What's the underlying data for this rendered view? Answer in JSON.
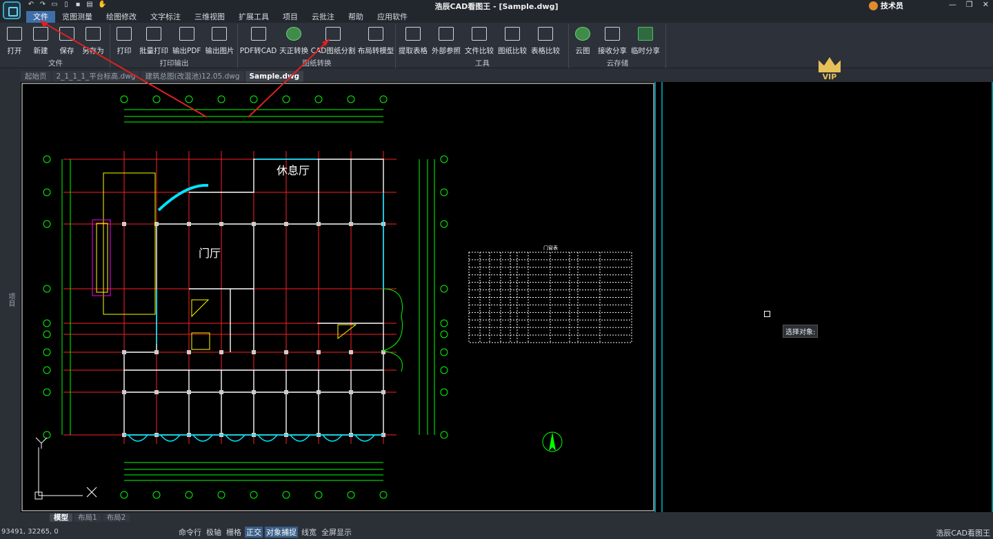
{
  "app": {
    "title": "浩辰CAD看图王 - [Sample.dwg]",
    "user": "技术员"
  },
  "menu": [
    "文件",
    "览图测量",
    "绘图修改",
    "文字标注",
    "三维视图",
    "扩展工具",
    "项目",
    "云批注",
    "帮助",
    "应用软件"
  ],
  "ribbon": {
    "groups": [
      {
        "label": "文件",
        "buttons": [
          "打开",
          "新建",
          "保存",
          "另存为"
        ]
      },
      {
        "label": "打印输出",
        "buttons": [
          "打印",
          "批量打印",
          "输出PDF",
          "输出图片"
        ]
      },
      {
        "label": "图纸转换",
        "buttons": [
          "PDF转CAD",
          "天正转换",
          "CAD图纸分割",
          "布局转模型"
        ]
      },
      {
        "label": "工具",
        "buttons": [
          "提取表格",
          "外部参照",
          "文件比较",
          "图纸比较",
          "表格比较"
        ]
      },
      {
        "label": "云存储",
        "buttons": [
          "云图",
          "接收分享",
          "临时分享"
        ]
      }
    ],
    "vip": "VIP"
  },
  "tabs": [
    "起始页",
    "2_1_1_1_平台标高.dwg",
    "建筑总图(改混池)12.05.dwg",
    "Sample.dwg"
  ],
  "sidebar": {
    "label": "项目"
  },
  "drawing": {
    "room_labels": [
      "休息厅",
      "门厅"
    ],
    "table_title": "门窗表",
    "prompt": "选择对象:"
  },
  "layout_tabs": [
    "模型",
    "布局1",
    "布局2"
  ],
  "status": {
    "coords": "93491, 32265, 0",
    "toggles": [
      "命令行",
      "极轴",
      "栅格",
      "正交",
      "对象捕捉",
      "线宽",
      "全屏显示"
    ],
    "brand": "浩辰CAD看图王"
  },
  "colors": {
    "accent": "#3f6fa8",
    "grid": "#ff2020",
    "dim": "#00ff00",
    "wall": "#ffffff",
    "window": "#00e5ff"
  }
}
